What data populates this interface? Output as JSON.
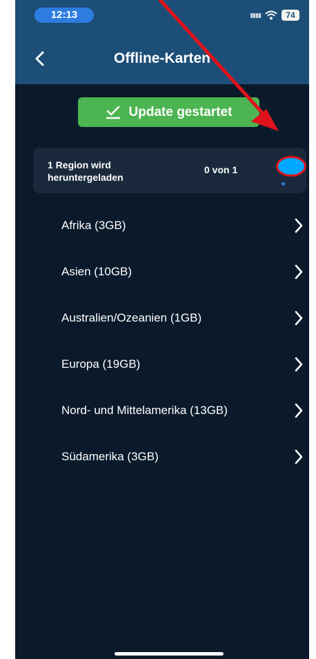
{
  "status_bar": {
    "time": "12:13",
    "battery": "74"
  },
  "header": {
    "title": "Offline-Karten"
  },
  "update_button": {
    "label": "Update gestartet"
  },
  "download_card": {
    "status": "1 Region wird heruntergeladen",
    "count": "0 von 1"
  },
  "regions": [
    {
      "label": "Afrika (3GB)"
    },
    {
      "label": "Asien (10GB)"
    },
    {
      "label": "Australien/Ozeanien (1GB)"
    },
    {
      "label": "Europa (19GB)"
    },
    {
      "label": "Nord- und Mittelamerika (13GB)"
    },
    {
      "label": "Südamerika (3GB)"
    }
  ],
  "colors": {
    "header": "#1c4e78",
    "background": "#0b1a2b",
    "accent_green": "#4cb450",
    "progress_blue": "#00a8ff",
    "annotation_red": "#e0131b"
  }
}
